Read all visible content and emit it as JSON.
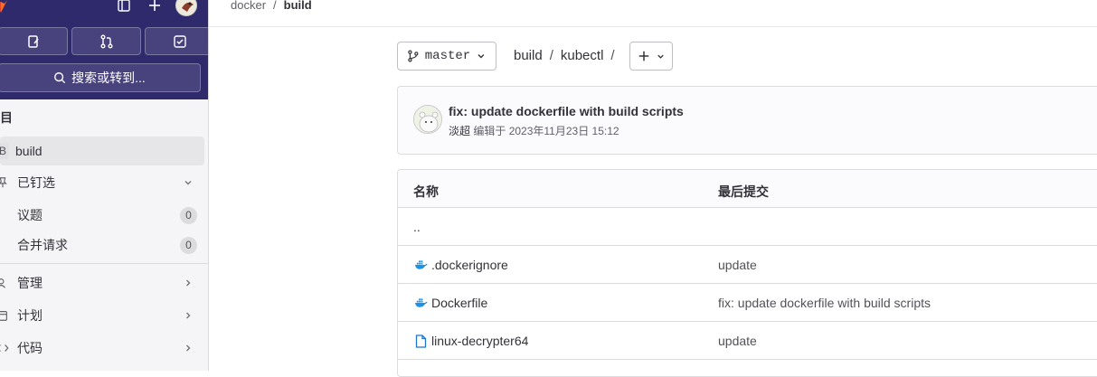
{
  "sidebar": {
    "search_label": "搜索或转到...",
    "section_heading": "目",
    "project_letter": "B",
    "project_name": "build",
    "pinned": {
      "label": "已钉选"
    },
    "pinned_items": [
      {
        "label": "议题",
        "count": "0"
      },
      {
        "label": "合并请求",
        "count": "0"
      }
    ],
    "groups": [
      {
        "label": "管理",
        "icon": "manage-icon"
      },
      {
        "label": "计划",
        "icon": "plan-icon"
      },
      {
        "label": "代码",
        "icon": "code-icon"
      }
    ]
  },
  "breadcrumb": {
    "parent": "docker",
    "sep": "/",
    "current": "build"
  },
  "repo": {
    "branch": "master",
    "path": [
      "build",
      "kubectl"
    ],
    "path_sep": "/"
  },
  "commit": {
    "title": "fix: update dockerfile with build scripts",
    "author": "淡超",
    "meta": "编辑于 2023年11月23日 15:12"
  },
  "files": {
    "headers": {
      "name": "名称",
      "last_commit": "最后提交"
    },
    "parent_dir": "..",
    "rows": [
      {
        "name": ".dockerignore",
        "icon": "docker-icon",
        "commit": "update"
      },
      {
        "name": "Dockerfile",
        "icon": "docker-icon",
        "commit": "fix: update dockerfile with build scripts"
      },
      {
        "name": "linux-decrypter64",
        "icon": "file-icon",
        "commit": "update"
      }
    ]
  },
  "colors": {
    "sidebar_top": "#2f2a6b",
    "docker_blue": "#1d91e6",
    "link_blue": "#1f75cb"
  }
}
